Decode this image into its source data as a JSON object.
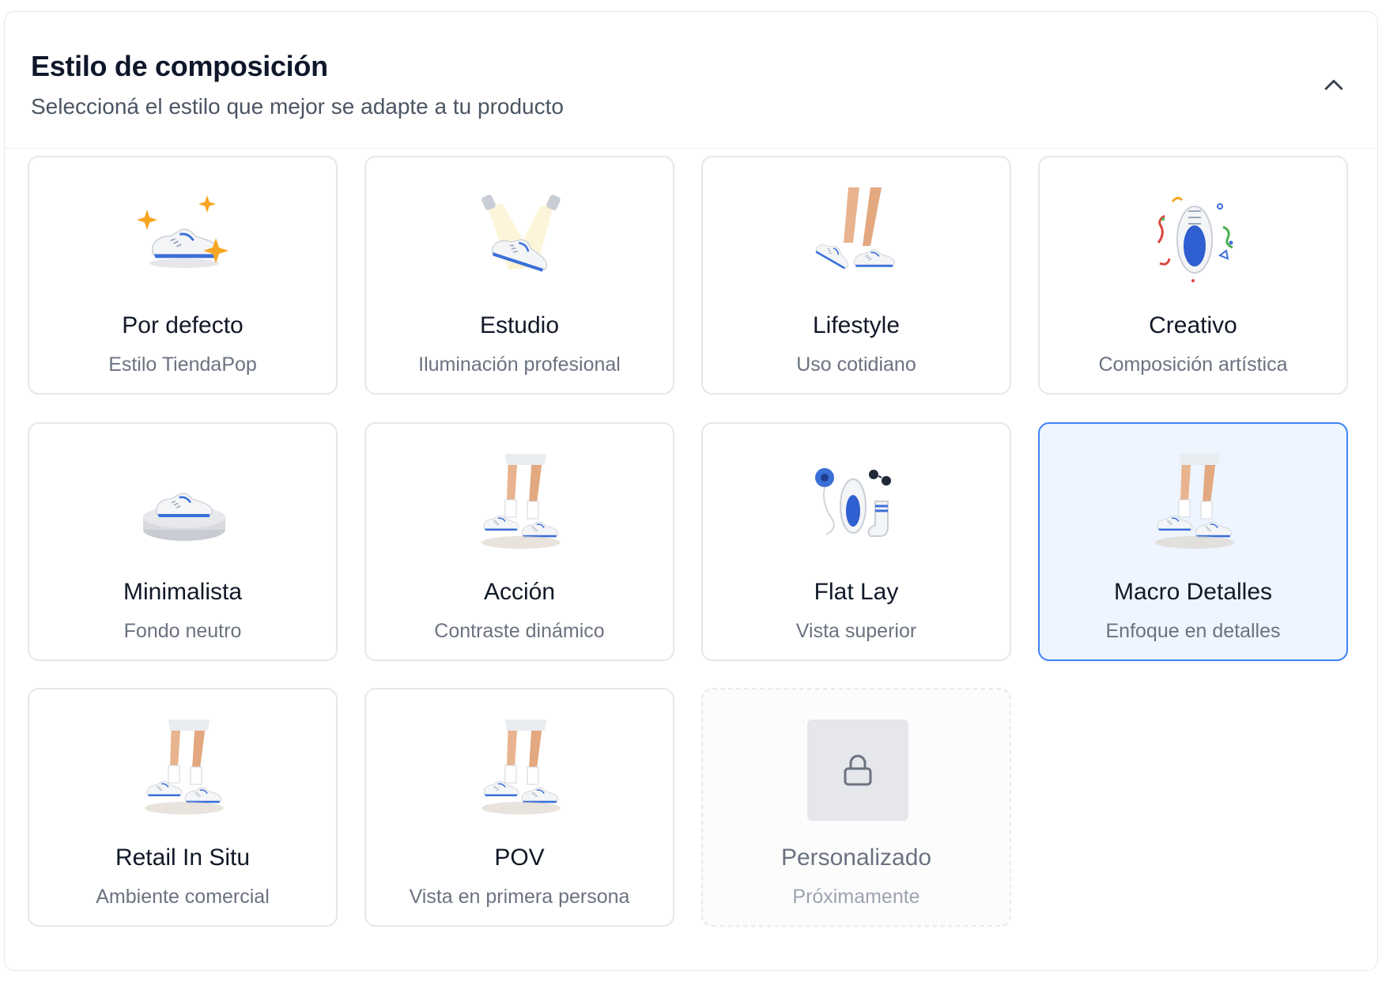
{
  "header": {
    "title": "Estilo de composición",
    "subtitle": "Seleccioná el estilo que mejor se adapte a tu producto",
    "collapse_icon": "chevron-up-icon"
  },
  "colors": {
    "selected_border": "#3b82f6",
    "selected_background": "#eef5ff",
    "shoe_accent": "#3b6fd8",
    "star": "#f6a623"
  },
  "styles": [
    {
      "name": "Por defecto",
      "description": "Estilo TiendaPop",
      "icon": "sneaker-stars-icon",
      "selected": false,
      "disabled": false
    },
    {
      "name": "Estudio",
      "description": "Iluminación profesional",
      "icon": "sneaker-spotlights-icon",
      "selected": false,
      "disabled": false
    },
    {
      "name": "Lifestyle",
      "description": "Uso cotidiano",
      "icon": "legs-walking-icon",
      "selected": false,
      "disabled": false
    },
    {
      "name": "Creativo",
      "description": "Composición artística",
      "icon": "sneaker-confetti-icon",
      "selected": false,
      "disabled": false
    },
    {
      "name": "Minimalista",
      "description": "Fondo neutro",
      "icon": "sneaker-pedestal-icon",
      "selected": false,
      "disabled": false
    },
    {
      "name": "Acción",
      "description": "Contraste dinámico",
      "icon": "legs-running-icon",
      "selected": false,
      "disabled": false
    },
    {
      "name": "Flat Lay",
      "description": "Vista superior",
      "icon": "flat-lay-items-icon",
      "selected": false,
      "disabled": false
    },
    {
      "name": "Macro Detalles",
      "description": "Enfoque en detalles",
      "icon": "legs-running-icon",
      "selected": true,
      "disabled": false
    },
    {
      "name": "Retail In Situ",
      "description": "Ambiente comercial",
      "icon": "legs-running-icon",
      "selected": false,
      "disabled": false
    },
    {
      "name": "POV",
      "description": "Vista en primera persona",
      "icon": "legs-running-icon",
      "selected": false,
      "disabled": false
    },
    {
      "name": "Personalizado",
      "description": "Próximamente",
      "icon": "lock-icon",
      "selected": false,
      "disabled": true
    }
  ]
}
